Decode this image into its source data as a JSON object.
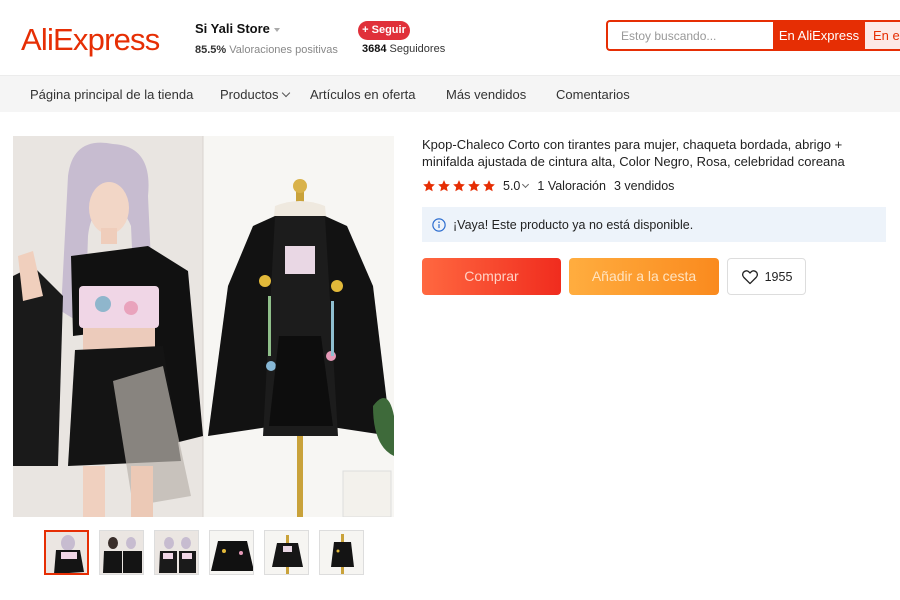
{
  "header": {
    "logo": "AliExpress",
    "store_name": "Si Yali Store",
    "rating_percent": "85.5%",
    "rating_label": "Valoraciones positivas",
    "follow_label": "+ Seguir",
    "followers_count": "3684",
    "followers_label": "Seguidores",
    "search_placeholder": "Estoy buscando...",
    "search_ali_label": "En AliExpress",
    "search_store_label": "En es"
  },
  "nav": {
    "items": [
      "Página principal de la tienda",
      "Productos",
      "Artículos en oferta",
      "Más vendidos",
      "Comentarios"
    ]
  },
  "product": {
    "title": "Kpop-Chaleco Corto con tirantes para mujer, chaqueta bordada, abrigo + minifalda ajustada de cintura alta, Color Negro, Rosa, celebridad coreana",
    "stars": 5,
    "rating": "5.0",
    "reviews": "1 Valoración",
    "sold": "3 vendidos",
    "notice": "¡Vaya! Este producto ya no está disponible.",
    "buy_label": "Comprar",
    "cart_label": "Añadir a la cesta",
    "wishlist_count": "1955",
    "thumbnail_count": 6,
    "active_thumbnail": 1
  },
  "colors": {
    "brand": "#e62e04",
    "star": "#e62e04",
    "notice_bg": "#edf3fa",
    "buy_btn": "#f5452a",
    "cart_btn": "#fb9b2e"
  }
}
